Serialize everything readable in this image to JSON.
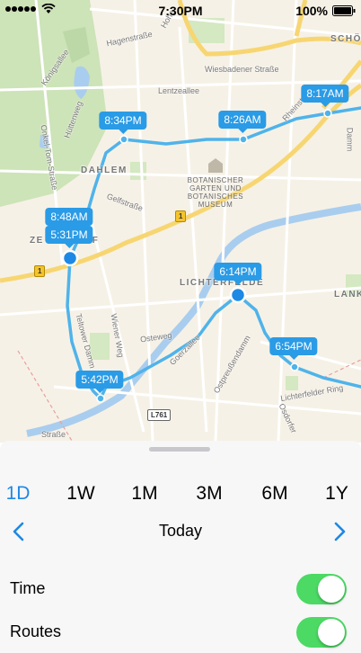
{
  "status_bar": {
    "time": "7:30PM",
    "battery": "100%"
  },
  "map": {
    "place_labels": [
      "DAHLEM",
      "ZE",
      "RF",
      "LICHTERFELDE",
      "SCHÖ",
      "LANK"
    ],
    "museum_label": [
      "BOTANISCHER",
      "GARTEN UND",
      "BOTANISCHES",
      "MUSEUM"
    ],
    "streets": [
      "Hagenstraße",
      "Wiesbadener Straße",
      "Lentzeallee",
      "Königsallee",
      "Hüttenweg",
      "Onkel-Tom-Straße",
      "Rheinstraße",
      "Damm",
      "Gelfstraße",
      "Teltower Damm",
      "Wiener Weg",
      "Osteweg",
      "Goerzallee",
      "Ostpreußendamm",
      "Lichterfelder Ring",
      "Osdorfer",
      "Straße",
      "Hohe"
    ],
    "shields": [
      "1",
      "1",
      "L761"
    ],
    "callouts": [
      "8:17AM",
      "8:26AM",
      "8:34PM",
      "8:48AM",
      "5:31PM",
      "6:14PM",
      "6:54PM",
      "5:42PM"
    ]
  },
  "time_ranges": [
    {
      "label": "1D",
      "active": true
    },
    {
      "label": "1W",
      "active": false
    },
    {
      "label": "1M",
      "active": false
    },
    {
      "label": "3M",
      "active": false
    },
    {
      "label": "6M",
      "active": false
    },
    {
      "label": "1Y",
      "active": false
    }
  ],
  "nav": {
    "title": "Today",
    "prev_icon": "chevron-left-icon",
    "next_icon": "chevron-right-icon"
  },
  "toggles": [
    {
      "label": "Time",
      "on": true
    },
    {
      "label": "Routes",
      "on": true
    }
  ],
  "colors": {
    "accent": "#1e88e5",
    "route": "#4fb3ea",
    "callout": "#2a9be6",
    "switch_on": "#4cd964"
  }
}
